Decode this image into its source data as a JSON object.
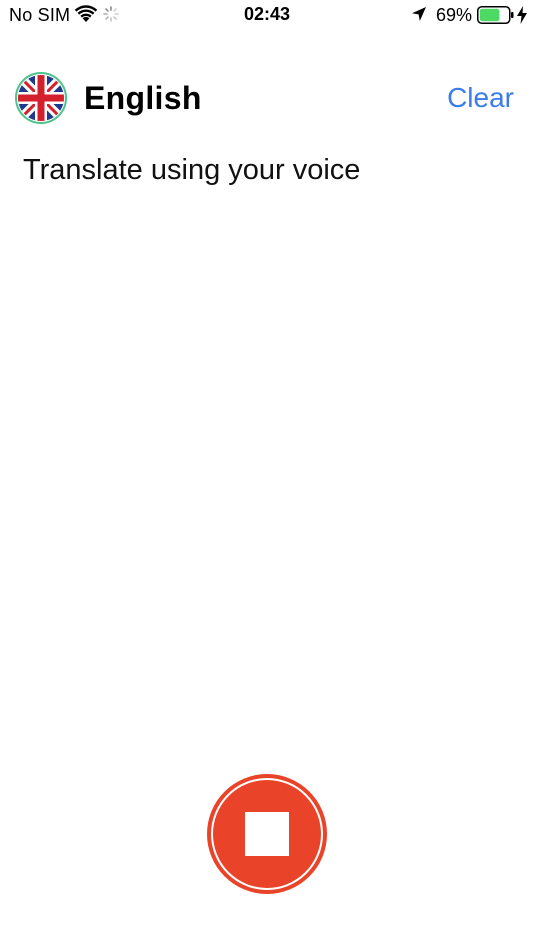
{
  "status_bar": {
    "carrier": "No SIM",
    "time": "02:43",
    "battery_percent": "69%",
    "battery_level": 0.69,
    "icons": [
      "wifi-icon",
      "activity-spinner-icon",
      "location-arrow-icon",
      "battery-icon",
      "charging-bolt-icon"
    ]
  },
  "header": {
    "flag_icon": "uk-flag-icon",
    "language": "English",
    "clear_label": "Clear"
  },
  "main": {
    "prompt": "Translate using your voice"
  },
  "record": {
    "icon": "stop-icon",
    "state": "recording"
  },
  "colors": {
    "accent_blue": "#3a7de8",
    "record_red": "#e9442a",
    "battery_green": "#4cd964"
  }
}
